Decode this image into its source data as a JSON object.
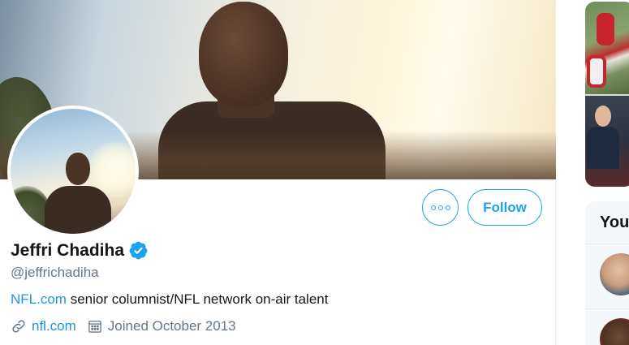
{
  "profile": {
    "display_name": "Jeffri Chadiha",
    "handle": "@jeffrichadiha",
    "verified": true,
    "bio_link": "NFL.com",
    "bio_text": " senior columnist/NFL network on-air talent",
    "website": "nfl.com",
    "joined": "Joined October 2013"
  },
  "actions": {
    "follow_label": "Follow",
    "more_icon": "more-dots-icon"
  },
  "icons": {
    "verified": "verified-badge-icon",
    "link": "link-icon",
    "calendar": "calendar-icon"
  },
  "sidebar": {
    "who_to_follow_title": "You"
  },
  "colors": {
    "accent": "#1da1f2",
    "link": "#1b95e0",
    "secondary_text": "#657786",
    "primary_text": "#14171a"
  }
}
